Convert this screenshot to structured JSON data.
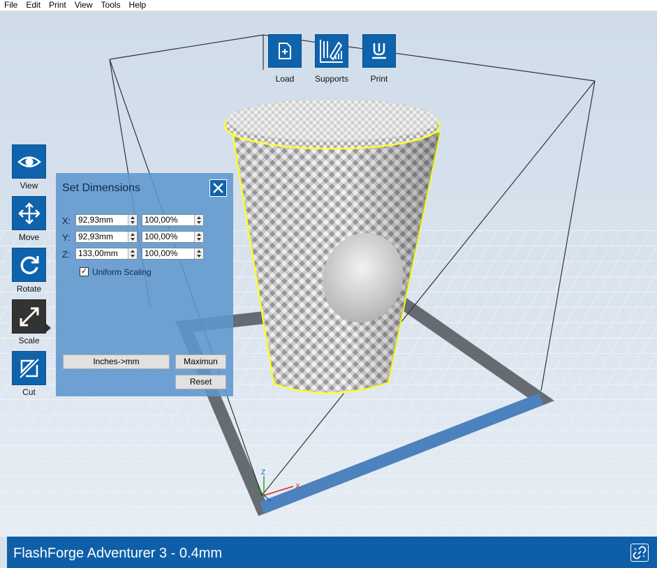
{
  "menu": [
    "File",
    "Edit",
    "Print",
    "View",
    "Tools",
    "Help"
  ],
  "toolbar": {
    "load_label": "Load",
    "supports_label": "Supports",
    "print_label": "Print"
  },
  "tools": [
    {
      "label": "View"
    },
    {
      "label": "Move"
    },
    {
      "label": "Rotate"
    },
    {
      "label": "Scale"
    },
    {
      "label": "Cut"
    }
  ],
  "dimensions": {
    "title": "Set Dimensions",
    "x_label": "X:",
    "y_label": "Y:",
    "z_label": "Z:",
    "x_mm": "92,93mm",
    "x_pct": "100,00%",
    "y_mm": "92,93mm",
    "y_pct": "100,00%",
    "z_mm": "133,00mm",
    "z_pct": "100,00%",
    "uniform_scaling_label": "Uniform Scaling",
    "uniform_scaling_checked": true,
    "inches_button": "Inches->mm",
    "maximum_button": "Maximun",
    "reset_button": "Reset"
  },
  "axes": {
    "x": "X",
    "y": "Y",
    "z": "Z"
  },
  "status": {
    "printer": "FlashForge Adventurer 3 - 0.4mm"
  },
  "colors": {
    "accent": "#0f63ad",
    "selection": "#ffff33",
    "status_bar": "#0f5fa8"
  }
}
